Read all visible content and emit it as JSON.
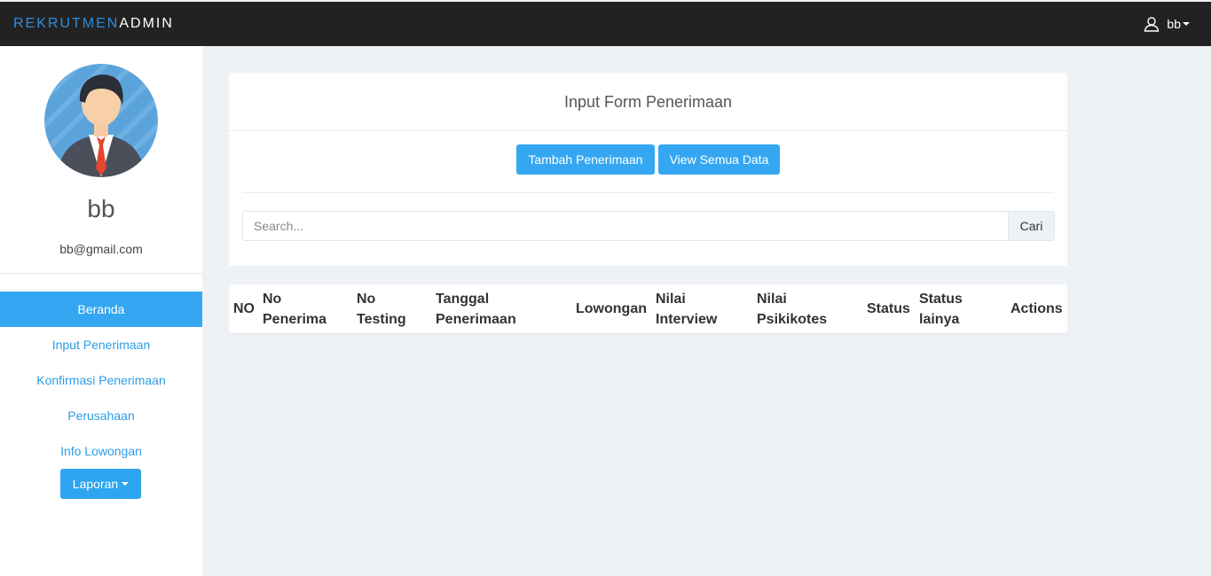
{
  "navbar": {
    "brand_part1": "REKRUTMEN",
    "brand_part2": "ADMIN",
    "user_label": "bb"
  },
  "sidebar": {
    "profile_name": "bb",
    "profile_email": "bb@gmail.com",
    "items": [
      {
        "label": "Beranda",
        "active": true
      },
      {
        "label": "Input Penerimaan"
      },
      {
        "label": "Konfirmasi Penerimaan"
      },
      {
        "label": "Perusahaan"
      },
      {
        "label": "Info Lowongan"
      }
    ],
    "laporan_label": "Laporan"
  },
  "form": {
    "title": "Input Form Penerimaan",
    "tambah_label": "Tambah Penerimaan",
    "view_label": "View Semua Data",
    "search_placeholder": "Search...",
    "search_button": "Cari"
  },
  "table": {
    "headers": {
      "no": "NO",
      "no_penerima_1": "No",
      "no_penerima_2": "Penerima",
      "no_testing_1": "No",
      "no_testing_2": "Testing",
      "tanggal_1": "Tanggal",
      "tanggal_2": "Penerimaan",
      "lowongan": "Lowongan",
      "nilai_interview_1": "Nilai",
      "nilai_interview_2": "Interview",
      "nilai_psikotes_1": "Nilai",
      "nilai_psikotes_2": "Psikikotes",
      "status": "Status",
      "status_lain_1": "Status",
      "status_lain_2": "lainya",
      "actions": "Actions"
    },
    "rows": []
  },
  "colors": {
    "navbar_bg": "#222222",
    "accent": "#35a7f2",
    "page_bg": "#eef1f5"
  },
  "icons": [
    "user-icon",
    "caret-down-icon"
  ]
}
